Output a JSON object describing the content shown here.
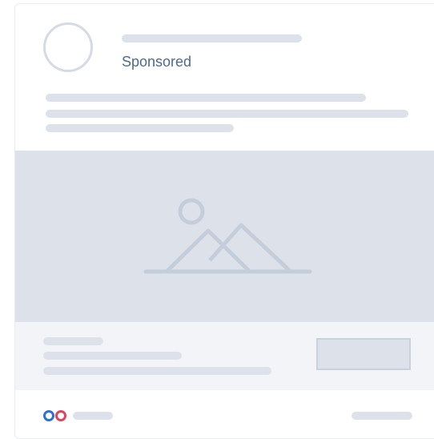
{
  "post": {
    "sponsored_label": "Sponsored"
  },
  "icons": {
    "media_placeholder": "image-placeholder-icon",
    "reaction_like": "like-reaction-icon",
    "reaction_love": "love-reaction-icon"
  },
  "colors": {
    "skeleton": "#dde2ea",
    "sponsored_text": "#4f6a8a",
    "like": "#2f6fd6",
    "love": "#e0435a"
  }
}
